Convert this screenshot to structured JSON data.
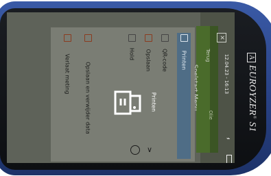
{
  "device": {
    "brand_prefix": "A",
    "brand_name": "EUROYZER",
    "brand_model": "S1"
  },
  "status_bar": {
    "datetime": "12.04.23 - 16:13",
    "bluetooth_icon": "bluetooth-icon",
    "battery_icon": "battery-icon"
  },
  "header": {
    "title": "Snelstart Menu",
    "back_label": "Terug",
    "secondary_label": "Opslaan",
    "third_label": "Olie"
  },
  "menu": {
    "items": [
      {
        "label": "Printen",
        "icon": "printer-icon",
        "selected": true
      },
      {
        "label": "QR-code",
        "icon": "qr-code-icon",
        "selected": false
      },
      {
        "label": "Opslaan",
        "icon": "save-icon",
        "selected": false
      },
      {
        "label": "Hold",
        "icon": "pause-icon",
        "selected": false
      },
      {
        "label": "Opslaan en verwijder data",
        "icon": "save-delete-icon",
        "selected": false
      },
      {
        "label": "Verlaat meting",
        "icon": "exit-icon",
        "selected": false
      }
    ],
    "scroll_down_icon": "chevron-down-icon",
    "clock_icon": "clock-icon"
  },
  "overlay": {
    "label": "Printen",
    "icon": "printer-icon"
  },
  "colors": {
    "screen_bg": "#5e6259",
    "selected_bg": "#4f6d86",
    "device_body": "#2a4488"
  }
}
